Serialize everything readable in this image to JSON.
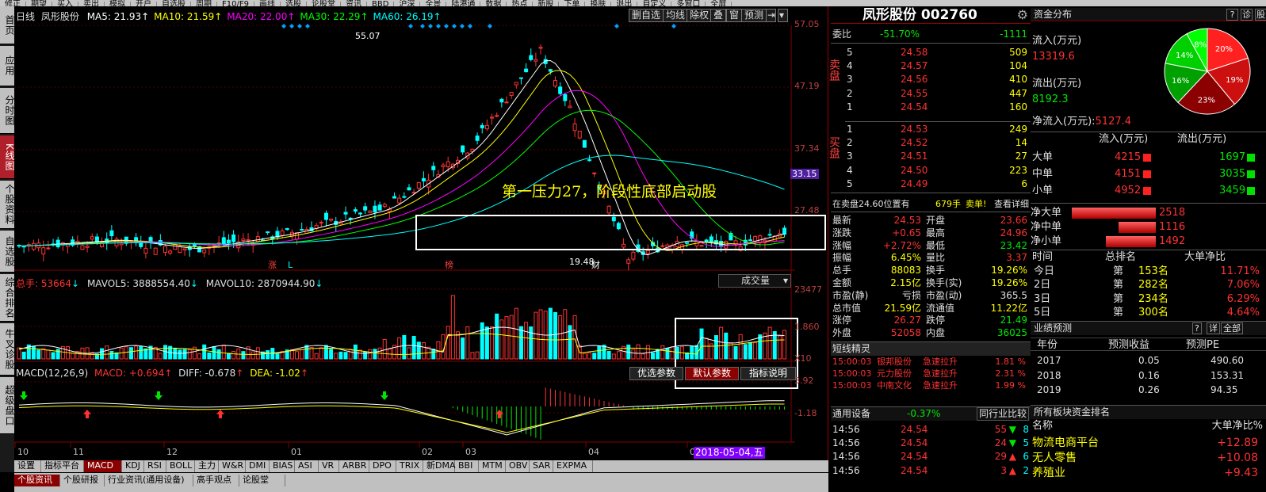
{
  "topbar": {
    "items": [
      "修正",
      "期望",
      "买入",
      "卖出",
      "模拟",
      "开户",
      "自选股",
      "周期",
      "F10/F9",
      "画线",
      "选股",
      "论股堂",
      "资讯",
      "BBD",
      "沪深",
      "全景",
      "陆港通",
      "数据",
      "热点",
      "新股",
      "下单",
      "换肤",
      "退出",
      "自定义",
      "多窗口",
      "全屏"
    ]
  },
  "left_tabs": [
    "首页",
    "应用",
    "分时图",
    "K线图",
    "个股资料",
    "自选股",
    "综合排名",
    "牛叉诊股",
    "超级盘口"
  ],
  "chart": {
    "period_label": "日线",
    "stock_name": "凤形股份",
    "ma": [
      {
        "label": "MA5: 21.93",
        "color": "#ffffff"
      },
      {
        "label": "MA10: 21.59",
        "color": "#ffff00"
      },
      {
        "label": "MA20: 22.00",
        "color": "#ff00ff"
      },
      {
        "label": "MA30: 22.29",
        "color": "#00ff00"
      },
      {
        "label": "MA60: 26.19",
        "color": "#00ffff"
      }
    ],
    "tools": [
      "删自选",
      "均线",
      "除权",
      "叠",
      "窗",
      "预测"
    ],
    "price_axis": [
      "57.05",
      "47.19",
      "37.34",
      "33.15",
      "27.48"
    ],
    "high_label": "55.07",
    "low_label": "19.48",
    "annotation": "第一压力27，阶段性底部启动股",
    "markers": [
      "涨",
      "L",
      "榜",
      "财"
    ],
    "vol_header": {
      "total": "总手: 53664",
      "mavol5": "MAVOL5: 3888554.40",
      "mavol10": "MAVOL10: 2870944.90",
      "dropdown": "成交量"
    },
    "vol_axis": [
      "23477",
      "1.860",
      "X10"
    ],
    "macd_header": {
      "name": "MACD(12,26,9)",
      "macd": "MACD: +0.694",
      "diff": "DIFF: -0.678",
      "dea": "DEA: -1.02"
    },
    "macd_buttons": [
      "优选参数",
      "默认参数",
      "指标说明"
    ],
    "macd_axis": [
      "3.92",
      "-1.18"
    ],
    "x_axis": [
      "10",
      "11",
      "12",
      "01",
      "02",
      "03",
      "04",
      "05"
    ],
    "cursor_date": "2018-05-04,五"
  },
  "bottom_tabs": [
    "设置",
    "指标平台",
    "MACD",
    "KDJ",
    "RSI",
    "BOLL",
    "主力",
    "W&R",
    "DMI",
    "BIAS",
    "ASI",
    "VR",
    "ARBR",
    "DPO",
    "TRIX",
    "新DMA",
    "BBI",
    "MTM",
    "OBV",
    "SAR",
    "EXPMA"
  ],
  "bottom_tabs2": [
    "个股资讯",
    "个股研报",
    "行业资讯(通用设备)",
    "高手观点",
    "论股堂"
  ],
  "quote": {
    "title": "凤形股份 002760",
    "weibi": {
      "label": "委比",
      "pct": "-51.70%",
      "diff": "-1111"
    },
    "sell": [
      {
        "n": "5",
        "price": "24.58",
        "vol": "509"
      },
      {
        "n": "4",
        "price": "24.57",
        "vol": "104"
      },
      {
        "n": "3",
        "price": "24.56",
        "vol": "410"
      },
      {
        "n": "2",
        "price": "24.55",
        "vol": "447"
      },
      {
        "n": "1",
        "price": "24.54",
        "vol": "160"
      }
    ],
    "buy": [
      {
        "n": "1",
        "price": "24.53",
        "vol": "249"
      },
      {
        "n": "2",
        "price": "24.52",
        "vol": "14"
      },
      {
        "n": "3",
        "price": "24.51",
        "vol": "27"
      },
      {
        "n": "4",
        "price": "24.50",
        "vol": "223"
      },
      {
        "n": "5",
        "price": "24.49",
        "vol": "6"
      }
    ],
    "sell_label": "卖盘",
    "buy_label": "买盘",
    "notice": {
      "text": "在卖盘24.60位置有",
      "qty": "679手",
      "side": "卖单!",
      "link": "查看详细"
    },
    "stats": [
      [
        "最新",
        "24.53",
        "开盘",
        "23.66"
      ],
      [
        "涨跌",
        "+0.65",
        "最高",
        "24.96"
      ],
      [
        "涨幅",
        "+2.72%",
        "最低",
        "23.42"
      ],
      [
        "振幅",
        "6.45%",
        "量比",
        "3.37"
      ],
      [
        "总手",
        "88083",
        "换手",
        "19.26%"
      ],
      [
        "金额",
        "2.15亿",
        "换手(实)",
        "19.26%"
      ],
      [
        "市盈(静)",
        "亏损",
        "市盈(动)",
        "365.5"
      ],
      [
        "总市值",
        "21.59亿",
        "流通值",
        "11.22亿"
      ],
      [
        "涨停",
        "26.27",
        "跌停",
        "21.49"
      ],
      [
        "外盘",
        "52058",
        "内盘",
        "36025"
      ]
    ],
    "wizard": {
      "title": "短线精灵",
      "rows": [
        [
          "15:00:03",
          "银邦股份",
          "急速拉升",
          "1.81 %"
        ],
        [
          "15:00:03",
          "元力股份",
          "急速拉升",
          "2.31 %"
        ],
        [
          "15:00:03",
          "中南文化",
          "急速拉升",
          "1.99 %"
        ]
      ]
    },
    "industry": {
      "name": "通用设备",
      "pct": "-0.37%",
      "link": "同行业比较"
    },
    "ticks": [
      [
        "14:56",
        "24.54",
        "55",
        "8"
      ],
      [
        "14:56",
        "24.54",
        "24",
        "5"
      ],
      [
        "14:56",
        "24.54",
        "29",
        "6"
      ],
      [
        "14:56",
        "24.54",
        "3",
        "2"
      ]
    ]
  },
  "fund": {
    "title": "资金分布",
    "btns": [
      "?",
      "诊",
      "股"
    ],
    "inflow_label": "流入(万元)",
    "inflow": "13319.6",
    "outflow_label": "流出(万元)",
    "outflow": "8192.3",
    "net_label": "净流入(万元):",
    "net": "5127.4",
    "pie": [
      {
        "label": "20%",
        "value": 20,
        "color": "#ff2020"
      },
      {
        "label": "19%",
        "value": 19,
        "color": "#cc1010"
      },
      {
        "label": "23%",
        "value": 23,
        "color": "#8b0000"
      },
      {
        "label": "16%",
        "value": 16,
        "color": "#00a000"
      },
      {
        "label": "14%",
        "value": 14,
        "color": "#00d000"
      },
      {
        "label": "8%",
        "value": 8,
        "color": "#00ff00"
      }
    ],
    "table_hdr": [
      "流入(万元)",
      "流出(万元)"
    ],
    "rows": [
      {
        "name": "大单",
        "in": "4215",
        "out": "1697"
      },
      {
        "name": "中单",
        "in": "4151",
        "out": "3035"
      },
      {
        "name": "小单",
        "in": "4952",
        "out": "3459"
      }
    ],
    "net_rows": [
      {
        "name": "净大单",
        "val": "2518",
        "frac": 1.0
      },
      {
        "name": "净中单",
        "val": "1116",
        "frac": 0.44
      },
      {
        "name": "净小单",
        "val": "1492",
        "frac": 0.59
      }
    ],
    "rank_hdr": [
      "时间",
      "总排名",
      "大单净比"
    ],
    "ranks": [
      [
        "今日",
        "第",
        "153名",
        "11.71%"
      ],
      [
        "2日",
        "第",
        "282名",
        "7.06%"
      ],
      [
        "3日",
        "第",
        "234名",
        "6.29%"
      ],
      [
        "5日",
        "第",
        "300名",
        "4.64%"
      ]
    ],
    "forecast": {
      "title": "业绩预测",
      "hdr": [
        "年份",
        "预测收益",
        "预测PE"
      ],
      "rows": [
        [
          "2017",
          "0.05",
          "490.60"
        ],
        [
          "2018",
          "0.16",
          "153.31"
        ],
        [
          "2019",
          "0.26",
          "94.35"
        ]
      ],
      "btns": [
        "?",
        "详",
        "全部"
      ]
    },
    "sector": {
      "title": "所有板块资金排名",
      "hdr": [
        "名称",
        "大单净比%"
      ],
      "rows": [
        [
          "物流电商平台",
          "+12.89"
        ],
        [
          "无人零售",
          "+10.08"
        ],
        [
          "养殖业",
          "+9.43"
        ]
      ]
    }
  }
}
